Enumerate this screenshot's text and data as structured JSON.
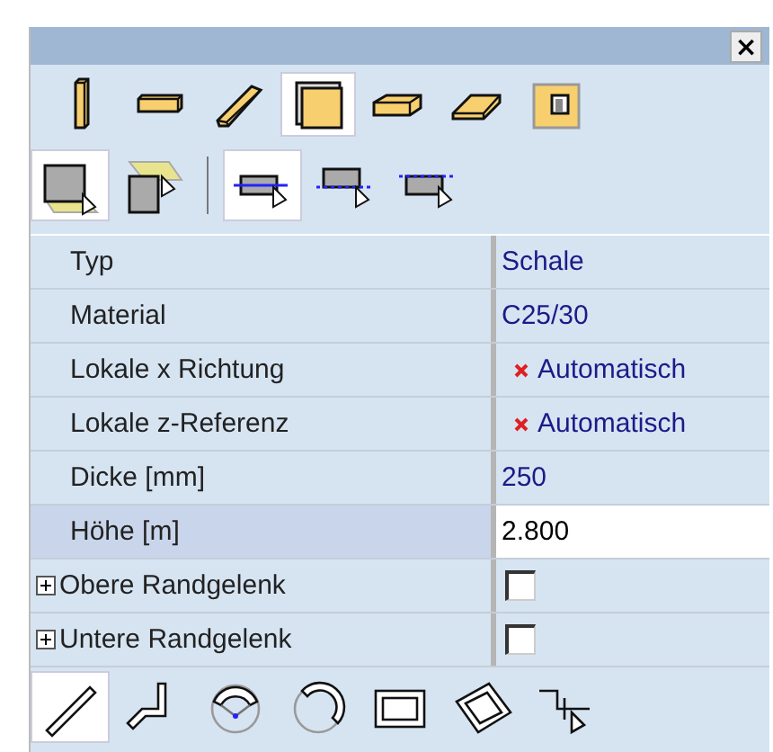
{
  "window": {
    "close": "×"
  },
  "toolbar_1": [
    {
      "selected": false
    },
    {
      "selected": false
    },
    {
      "selected": false
    },
    {
      "selected": true
    },
    {
      "selected": false
    },
    {
      "selected": false
    },
    {
      "selected": false
    }
  ],
  "toolbar_2_left": [
    {
      "selected": true
    },
    {
      "selected": false
    }
  ],
  "toolbar_2_right": [
    {
      "selected": true
    },
    {
      "selected": false
    },
    {
      "selected": false
    }
  ],
  "properties": [
    {
      "kind": "text",
      "label": "Typ",
      "value": "Schale",
      "selected": false
    },
    {
      "kind": "text",
      "label": "Material",
      "value": "C25/30",
      "selected": false
    },
    {
      "kind": "auto",
      "label": "Lokale x Richtung",
      "value": "Automatisch",
      "selected": false
    },
    {
      "kind": "auto",
      "label": "Lokale z-Referenz",
      "value": "Automatisch",
      "selected": false
    },
    {
      "kind": "text",
      "label": "Dicke [mm]",
      "value": "250",
      "selected": false
    },
    {
      "kind": "input",
      "label": "Höhe [m]",
      "value": "2.800",
      "selected": true
    },
    {
      "kind": "checkbox",
      "label": "Obere Randgelenk",
      "expanded": false,
      "checked": false,
      "selected": false
    },
    {
      "kind": "checkbox",
      "label": "Untere Randgelenk",
      "expanded": false,
      "checked": false,
      "selected": false
    }
  ],
  "toolbar_3": [
    {
      "selected": true
    },
    {
      "selected": false
    },
    {
      "selected": false
    },
    {
      "selected": false
    },
    {
      "selected": false
    },
    {
      "selected": false
    },
    {
      "selected": false
    }
  ]
}
